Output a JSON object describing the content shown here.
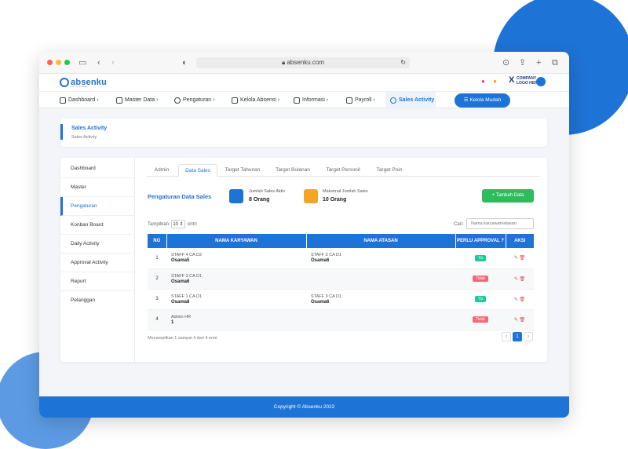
{
  "browser": {
    "url": "absenku.com"
  },
  "app": {
    "logo_text": "absenku",
    "logo_subtext": "Part of Omosoft",
    "company_x": "X",
    "company_line1": "COMPANY",
    "company_line2": "LOGO HERE"
  },
  "nav": {
    "items": [
      {
        "label": "Dashboard",
        "chev": "›"
      },
      {
        "label": "Master Data",
        "chev": "›"
      },
      {
        "label": "Pengaturan",
        "chev": "›"
      },
      {
        "label": "Kelola Absensi",
        "chev": "›"
      },
      {
        "label": "Informasi",
        "chev": "›"
      },
      {
        "label": "Payroll",
        "chev": "›"
      },
      {
        "label": "Sales Activity",
        "chev": ""
      }
    ],
    "kelola_mudah": "Kelola Mudah"
  },
  "page": {
    "title": "Sales Activity",
    "breadcrumb": "Sales Activity"
  },
  "sidebar": {
    "items": [
      "Dashboard",
      "Master",
      "Pengaturan",
      "Konban Board",
      "Daily Activity",
      "Approval Activity",
      "Report",
      "Pelanggan"
    ]
  },
  "tabs": [
    "Admin",
    "Data Sales",
    "Target Tahunan",
    "Target Bulanan",
    "Target Personil",
    "Target Poin"
  ],
  "section": {
    "title": "Pengaturan Data Sales",
    "stat1_label": "Jumlah Sales Aktiv",
    "stat1_value": "8 Orang",
    "stat2_label": "Maksimal Jumlah Sales",
    "stat2_value": "10 Orang",
    "add_button": "+  Tambah Data"
  },
  "table_controls": {
    "show_label": "Tampilkan",
    "show_value": "10 ⇕",
    "entries_label": "entri",
    "search_label": "Cari:",
    "search_placeholder": "Nama karyawan/atasan"
  },
  "table": {
    "headers": [
      "NO",
      "NAMA KARYAWAN",
      "NAMA ATASAN",
      "PERLU APPROVAL ?",
      "AKSI"
    ],
    "rows": [
      {
        "no": "1",
        "emp1": "STAFF 4 CA D2",
        "emp2": "Osama5",
        "sup1": "STAFF 3 CA D1",
        "sup2": "Osama6",
        "approval": "Ya"
      },
      {
        "no": "2",
        "emp1": "STAFF 3 CA D1",
        "emp2": "Osama6",
        "sup1": "",
        "sup2": "",
        "approval": "Tidak"
      },
      {
        "no": "3",
        "emp1": "STAFF 1 CA D1",
        "emp2": "Osama8",
        "sup1": "STAFF 3 CA D1",
        "sup2": "Osama6",
        "approval": "Ya"
      },
      {
        "no": "4",
        "emp1": "Admin HR",
        "emp2": "1",
        "sup1": "",
        "sup2": "",
        "approval": "Tidak"
      }
    ],
    "showing": "Menampilkan 1 sampai 4 dari 4 entri",
    "pager": [
      "‹",
      "1",
      "›"
    ]
  },
  "colors": {
    "primary": "#1e73d6",
    "success": "#2ebd5c",
    "badge_yes": "#20c997",
    "badge_no": "#f06a73"
  },
  "footer": {
    "text": "Copyright © Absenku 2022"
  }
}
